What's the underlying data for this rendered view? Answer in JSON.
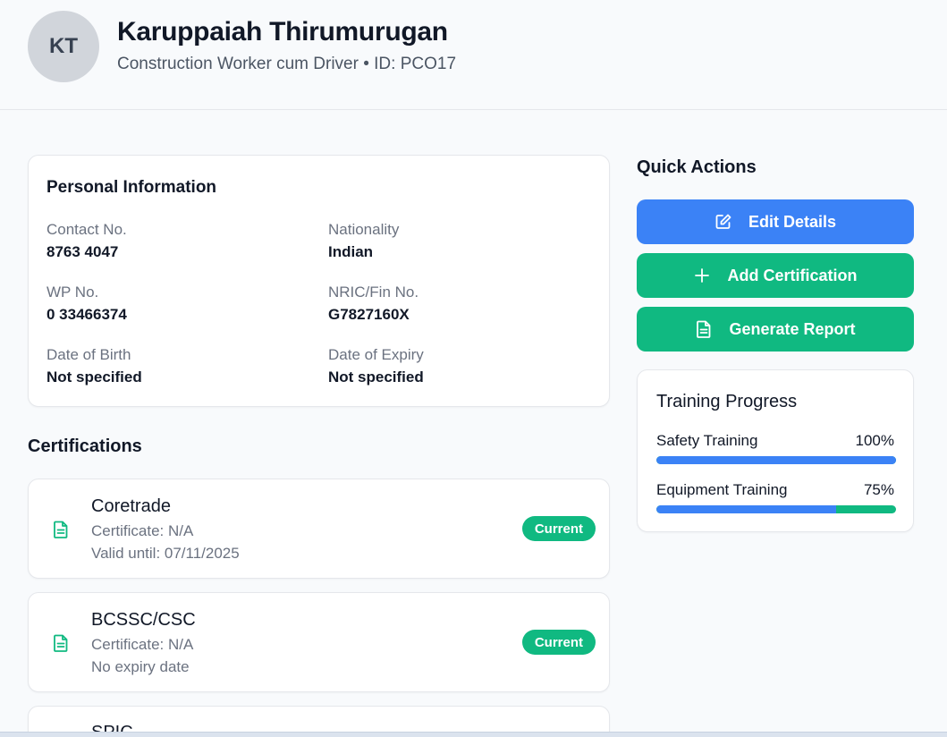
{
  "profile": {
    "initials": "KT",
    "name": "Karuppaiah Thirumurugan",
    "subtitle": "Construction Worker cum Driver • ID: PCO17"
  },
  "personal_info": {
    "title": "Personal Information",
    "fields": [
      {
        "label": "Contact No.",
        "value": "8763 4047"
      },
      {
        "label": "Nationality",
        "value": "Indian"
      },
      {
        "label": "WP No.",
        "value": "0 33466374"
      },
      {
        "label": "NRIC/Fin No.",
        "value": "G7827160X"
      },
      {
        "label": "Date of Birth",
        "value": "Not specified"
      },
      {
        "label": "Date of Expiry",
        "value": "Not specified"
      }
    ]
  },
  "certifications": {
    "title": "Certifications",
    "items": [
      {
        "name": "Coretrade",
        "certificate": "Certificate: N/A",
        "validity": "Valid until: 07/11/2025",
        "status": "Current"
      },
      {
        "name": "BCSSC/CSC",
        "certificate": "Certificate: N/A",
        "validity": "No expiry date",
        "status": "Current"
      },
      {
        "name": "SPIC"
      }
    ]
  },
  "quick_actions": {
    "title": "Quick Actions",
    "buttons": [
      {
        "label": "Edit Details",
        "icon": "edit-icon",
        "color": "#3b82f6"
      },
      {
        "label": "Add Certification",
        "icon": "plus-icon",
        "color": "#10b981"
      },
      {
        "label": "Generate Report",
        "icon": "document-icon",
        "color": "#10b981"
      }
    ]
  },
  "training_progress": {
    "title": "Training Progress",
    "items": [
      {
        "label": "Safety Training",
        "percent_text": "100%",
        "percent": 100
      },
      {
        "label": "Equipment Training",
        "percent_text": "75%",
        "percent": 75
      }
    ]
  },
  "colors": {
    "primary_blue": "#3b82f6",
    "success_green": "#10b981"
  }
}
